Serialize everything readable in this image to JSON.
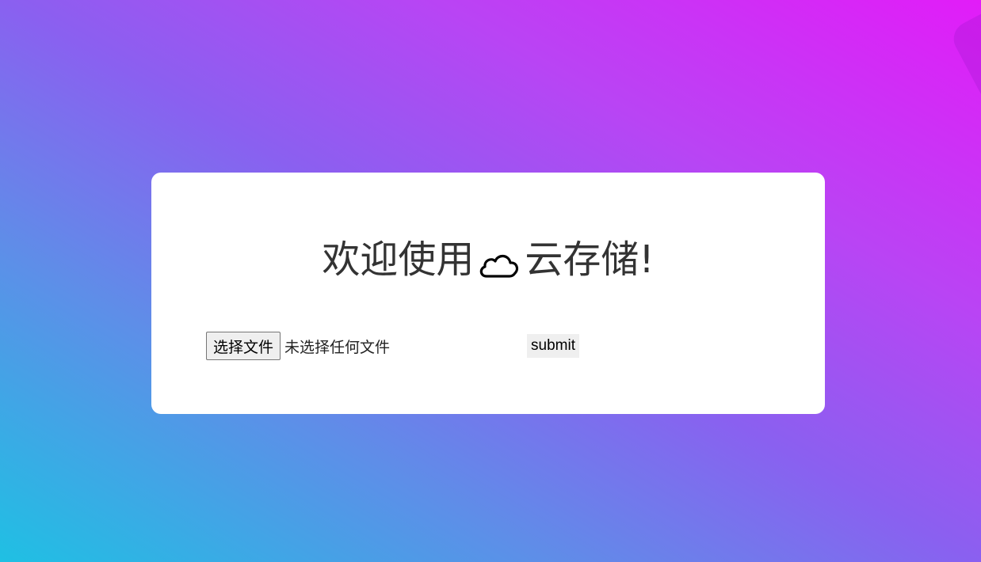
{
  "page": {
    "heading_before": "欢迎使用",
    "heading_icon": "cloud-icon",
    "heading_after": "云存储!"
  },
  "upload": {
    "choose_label": "选择文件",
    "status_text": "未选择任何文件",
    "submit_label": "submit"
  },
  "colors": {
    "gradient_start": "#1fc0e3",
    "gradient_end": "#e21cf8",
    "card": "#ffffff",
    "text": "#333333"
  }
}
